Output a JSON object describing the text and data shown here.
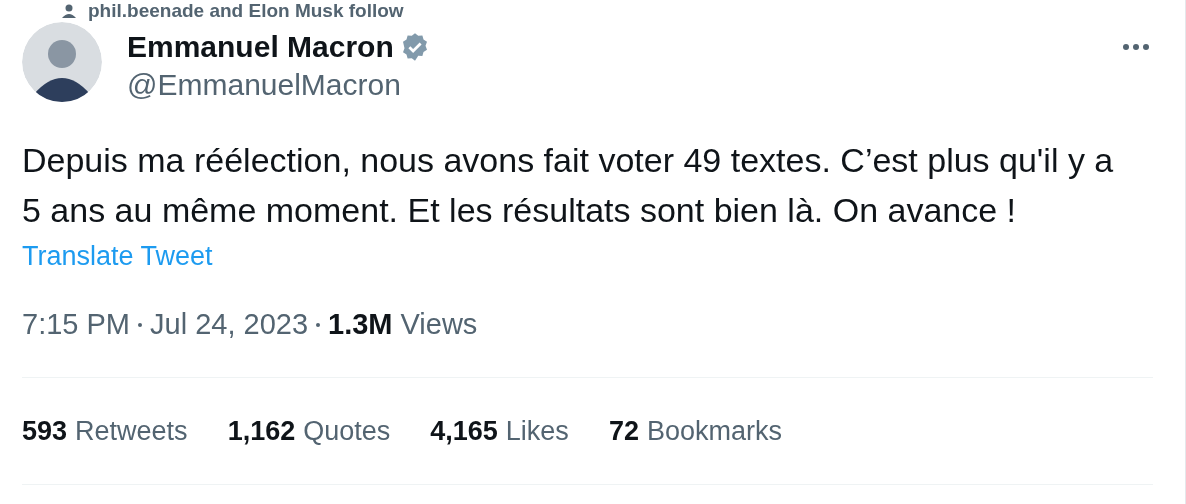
{
  "social_context": "phil.beenade and Elon Musk follow",
  "author": {
    "name": "Emmanuel Macron",
    "verified": true,
    "handle": "@EmmanuelMacron"
  },
  "tweet_text": [
    "Depuis ma réélection, nous avons fait voter 49 textes. C’est plus qu'il y a",
    "5 ans au même moment. Et les résultats sont bien là. On avance !"
  ],
  "translate_link": "Translate Tweet",
  "meta": {
    "time": "7:15 PM",
    "date": "Jul 24, 2023",
    "views_count": "1.3M",
    "views_label": "Views"
  },
  "stats": [
    {
      "count": "593",
      "label": "Retweets"
    },
    {
      "count": "1,162",
      "label": "Quotes"
    },
    {
      "count": "4,165",
      "label": "Likes"
    },
    {
      "count": "72",
      "label": "Bookmarks"
    }
  ]
}
